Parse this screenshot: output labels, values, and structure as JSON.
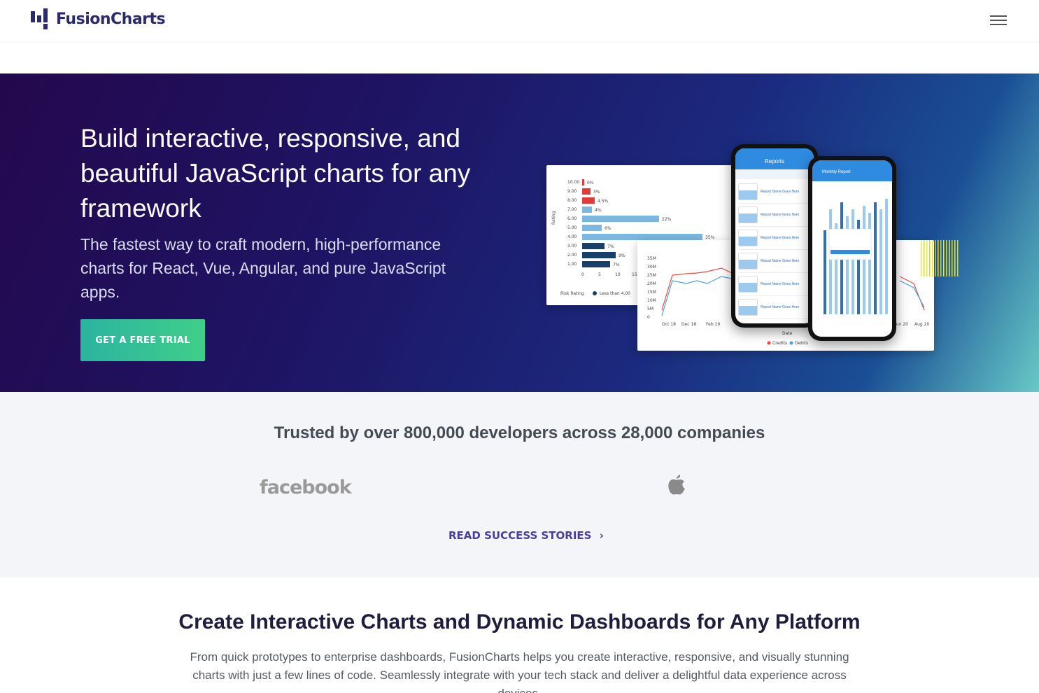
{
  "header": {
    "logo_text": "FusionCharts",
    "menu_icon": "hamburger-menu-icon"
  },
  "hero": {
    "title": "Build interactive, responsive, and beautiful JavaScript charts for any framework",
    "subtitle": "The fastest way to craft modern, high-performance charts for React, Vue, Angular, and pure JavaScript apps.",
    "cta_label": "GET A FREE TRIAL",
    "illustration": {
      "bar_card": {
        "axis_title": "Rating",
        "categories": [
          "10.00",
          "9.00",
          "8.00",
          "7.00",
          "6.00",
          "5.00",
          "4.00",
          "3.00",
          "2.00",
          "1.00"
        ],
        "labels": [
          "0%",
          "3%",
          "4.5%",
          "4%",
          "22%",
          "6%",
          "35%",
          "7%",
          "9%",
          "7%"
        ],
        "x_ticks": [
          "0",
          "5",
          "10",
          "15"
        ],
        "legend_title": "Risk Rating",
        "legend_item": "Less than 4.00"
      },
      "line_card": {
        "y_ticks": [
          "35M",
          "30M",
          "25M",
          "20M",
          "15M",
          "10M",
          "5M",
          "0"
        ],
        "x_ticks": [
          "Oct 18",
          "Dec 18",
          "Feb 19",
          "Jun 20",
          "Aug 20"
        ],
        "x_title": "Date",
        "legend": [
          "Credits",
          "Debits"
        ]
      },
      "phone_left": {
        "header": "Reports",
        "item_title": "Report Name Goes Here"
      },
      "phone_right": {
        "header": "Monthly Report"
      }
    }
  },
  "trusted": {
    "title": "Trusted by over 800,000 developers across 28,000 companies",
    "logos": [
      {
        "name": "facebook",
        "text": "facebook"
      },
      {
        "name": "apple",
        "icon": "apple-logo-icon"
      }
    ],
    "stories_label": "READ SUCCESS STORIES",
    "stories_icon": "chevron-right-icon"
  },
  "platform": {
    "title": "Create Interactive Charts and Dynamic Dashboards for Any Platform",
    "text": "From quick prototypes to enterprise dashboards, FusionCharts helps you create interactive, responsive, and visually stunning charts with just a few lines of code. Seamlessly integrate with your tech stack and deliver a delightful data experience across devices."
  }
}
